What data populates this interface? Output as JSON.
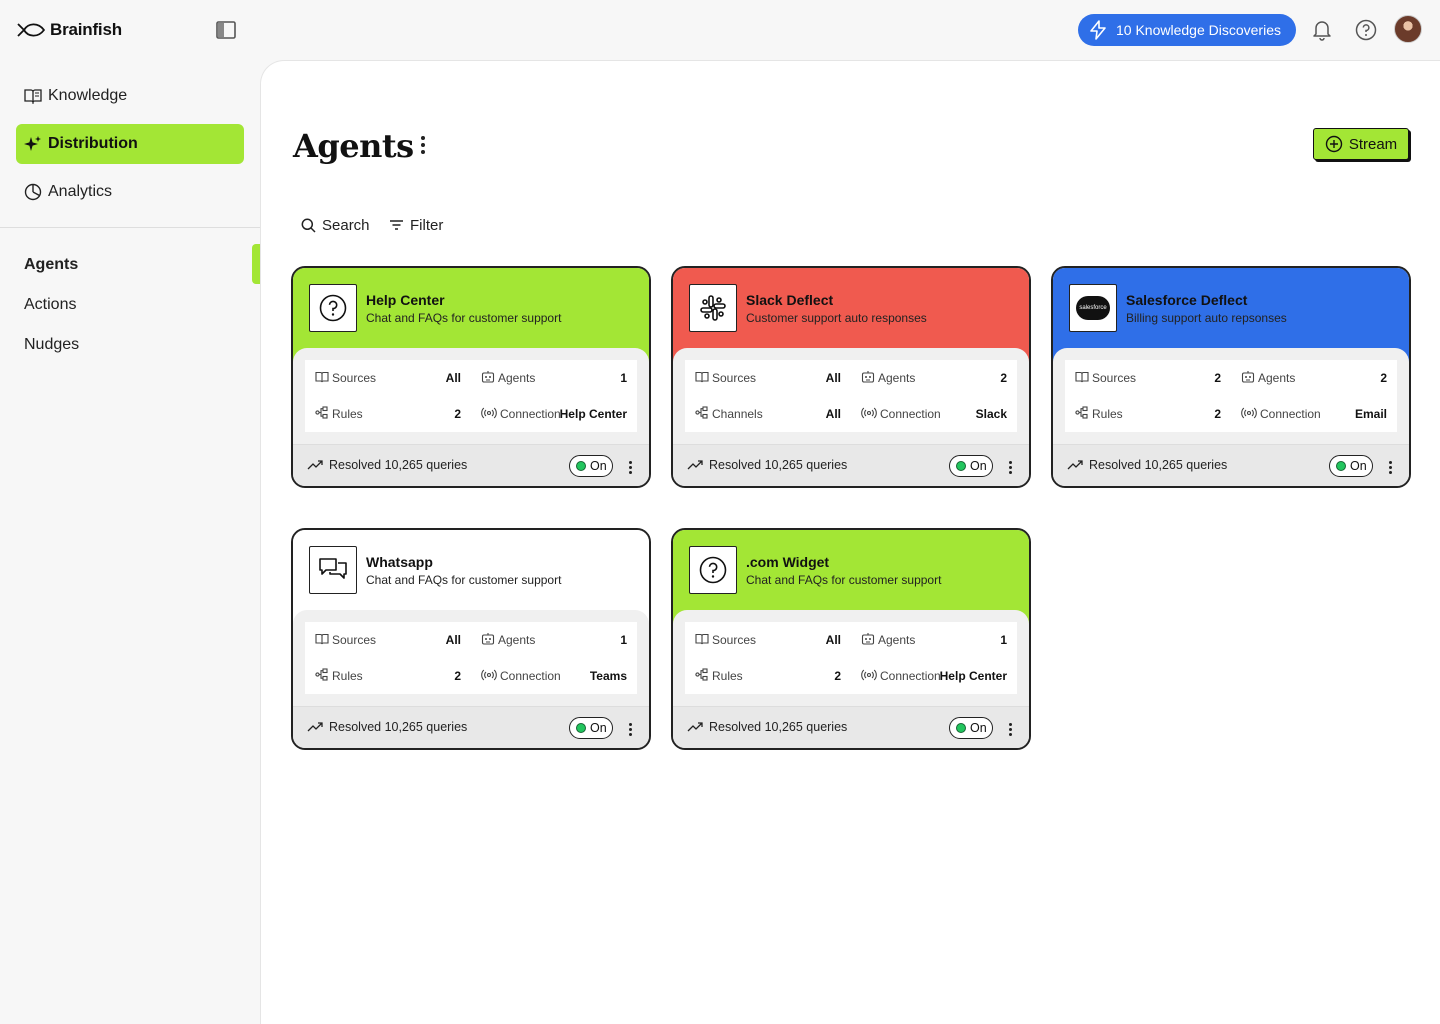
{
  "brand": {
    "name": "Brainfish"
  },
  "header": {
    "discoveries_label": "10 Knowledge Discoveries",
    "icons": [
      "lightning-icon",
      "bell-icon",
      "help-icon"
    ]
  },
  "sidebar": {
    "primary": [
      {
        "label": "Knowledge",
        "icon": "book-icon",
        "active": false
      },
      {
        "label": "Distribution",
        "icon": "sparkle-icon",
        "active": true
      },
      {
        "label": "Analytics",
        "icon": "pie-chart-icon",
        "active": false
      }
    ],
    "secondary": [
      {
        "label": "Agents",
        "active": true
      },
      {
        "label": "Actions",
        "active": false
      },
      {
        "label": "Nudges",
        "active": false
      }
    ]
  },
  "page": {
    "title": "Agents",
    "stream_label": "Stream",
    "search_label": "Search",
    "filter_label": "Filter"
  },
  "colors": {
    "green": "#a3e635",
    "red": "#f05a4f",
    "blue": "#2f6fe8",
    "white": "#ffffff"
  },
  "cards": [
    {
      "title": "Help Center",
      "subtitle": "Chat and FAQs for customer support",
      "color": "#a3e635",
      "icon": "question-circle-icon",
      "stats": [
        {
          "label": "Sources",
          "icon": "book-icon",
          "value": "All"
        },
        {
          "label": "Agents",
          "icon": "robot-icon",
          "value": "1"
        },
        {
          "label": "Rules",
          "icon": "flow-icon",
          "value": "2"
        },
        {
          "label": "Connection",
          "icon": "broadcast-icon",
          "value": "Help Center"
        }
      ],
      "resolved": "Resolved 10,265 queries",
      "status": "On"
    },
    {
      "title": "Slack Deflect",
      "subtitle": "Customer support auto responses",
      "color": "#f05a4f",
      "icon": "slack-icon",
      "stats": [
        {
          "label": "Sources",
          "icon": "book-icon",
          "value": "All"
        },
        {
          "label": "Agents",
          "icon": "robot-icon",
          "value": "2"
        },
        {
          "label": "Channels",
          "icon": "flow-icon",
          "value": "All"
        },
        {
          "label": "Connection",
          "icon": "broadcast-icon",
          "value": "Slack"
        }
      ],
      "resolved": "Resolved 10,265 queries",
      "status": "On"
    },
    {
      "title": "Salesforce Deflect",
      "subtitle": "Billing support auto repsonses",
      "color": "#2f6fe8",
      "icon": "salesforce-icon",
      "logo_text": "salesforce",
      "stats": [
        {
          "label": "Sources",
          "icon": "book-icon",
          "value": "2"
        },
        {
          "label": "Agents",
          "icon": "robot-icon",
          "value": "2"
        },
        {
          "label": "Rules",
          "icon": "flow-icon",
          "value": "2"
        },
        {
          "label": "Connection",
          "icon": "broadcast-icon",
          "value": "Email"
        }
      ],
      "resolved": "Resolved 10,265 queries",
      "status": "On"
    },
    {
      "title": "Whatsapp",
      "subtitle": "Chat and FAQs for customer support",
      "color": "#ffffff",
      "icon": "chat-bubbles-icon",
      "stats": [
        {
          "label": "Sources",
          "icon": "book-icon",
          "value": "All"
        },
        {
          "label": "Agents",
          "icon": "robot-icon",
          "value": "1"
        },
        {
          "label": "Rules",
          "icon": "flow-icon",
          "value": "2"
        },
        {
          "label": "Connection",
          "icon": "broadcast-icon",
          "value": "Teams"
        }
      ],
      "resolved": "Resolved 10,265 queries",
      "status": "On"
    },
    {
      "title": ".com Widget",
      "subtitle": "Chat and FAQs for customer support",
      "color": "#a3e635",
      "icon": "question-circle-icon",
      "stats": [
        {
          "label": "Sources",
          "icon": "book-icon",
          "value": "All"
        },
        {
          "label": "Agents",
          "icon": "robot-icon",
          "value": "1"
        },
        {
          "label": "Rules",
          "icon": "flow-icon",
          "value": "2"
        },
        {
          "label": "Connection",
          "icon": "broadcast-icon",
          "value": "Help Center"
        }
      ],
      "resolved": "Resolved 10,265 queries",
      "status": "On"
    }
  ]
}
